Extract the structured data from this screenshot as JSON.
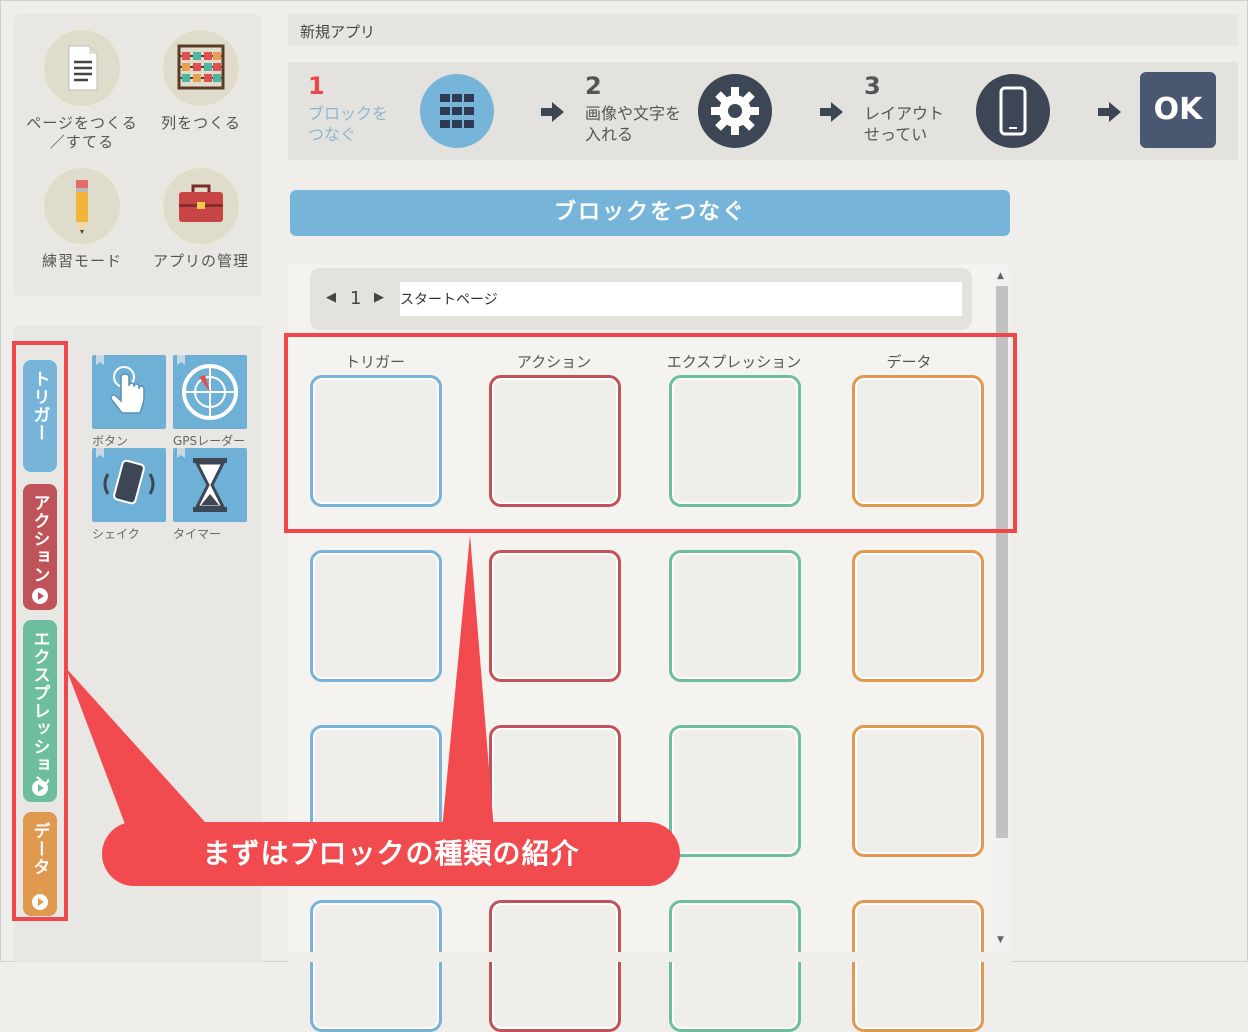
{
  "menu": {
    "items": [
      {
        "label_line1": "ページをつくる",
        "label_line2": "／すてる",
        "icon": "document-icon"
      },
      {
        "label_line1": "列をつくる",
        "label_line2": "",
        "icon": "abacus-icon"
      },
      {
        "label_line1": "練習モード",
        "label_line2": "",
        "icon": "pencil-icon"
      },
      {
        "label_line1": "アプリの管理",
        "label_line2": "",
        "icon": "toolbox-icon"
      }
    ]
  },
  "sidebar": {
    "categories": [
      {
        "label": "トリガー",
        "color": "#76b4d9"
      },
      {
        "label": "アクション",
        "color": "#c0525a"
      },
      {
        "label": "エクスプレッション",
        "color": "#6dbd9f"
      },
      {
        "label": "データ",
        "color": "#e0994f"
      }
    ],
    "blocks": [
      {
        "label": "ボタン",
        "icon": "tap-hand-icon"
      },
      {
        "label": "GPSレーダー",
        "icon": "gps-radar-icon"
      },
      {
        "label": "シェイク",
        "icon": "shake-phone-icon"
      },
      {
        "label": "タイマー",
        "icon": "hourglass-icon"
      }
    ]
  },
  "header": {
    "app_title": "新規アプリ"
  },
  "steps": [
    {
      "num": "1",
      "line1": "ブロックを",
      "line2": "つなぐ",
      "active": true
    },
    {
      "num": "2",
      "line1": "画像や文字を",
      "line2": "入れる",
      "active": false
    },
    {
      "num": "3",
      "line1": "レイアウト",
      "line2": "せってい",
      "active": false
    }
  ],
  "ok_label": "OK",
  "banner_title": "ブロックをつなぐ",
  "pager": {
    "prev": "◀",
    "page": "1",
    "next": "▶",
    "page_name": "スタートページ"
  },
  "columns": [
    {
      "label": "トリガー",
      "color": "#76b4d9"
    },
    {
      "label": "アクション",
      "color": "#c0525a"
    },
    {
      "label": "エクスプレッション",
      "color": "#6dbd9f"
    },
    {
      "label": "データ",
      "color": "#e0994f"
    }
  ],
  "scroll": {
    "up": "▲",
    "down": "▼"
  },
  "callout": "まずはブロックの種類の紹介",
  "colors": {
    "accent_blue": "#76b4d9",
    "action_red": "#c0525a",
    "expression_green": "#6dbd9f",
    "data_orange": "#e0994f",
    "annotation_red": "#f0474a",
    "dark_navy": "#4a5770"
  }
}
